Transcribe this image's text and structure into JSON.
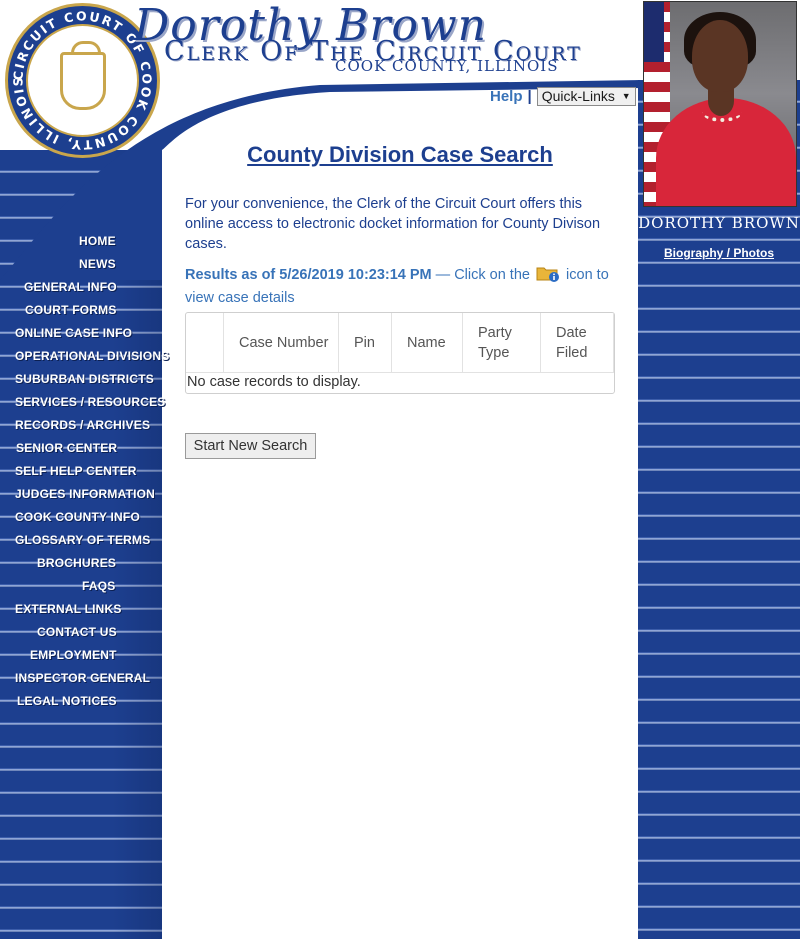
{
  "header": {
    "name": "Dorothy Brown",
    "office": "Clerk Of The Circuit Court",
    "county": "Cook County, Illinois",
    "seal_text": "CIRCUIT COURT OF COOK COUNTY, ILLINOIS"
  },
  "toplinks": {
    "help": "Help",
    "separator": "|",
    "quicklinks": "Quick-Links"
  },
  "sidebar": {
    "bio_name": "DOROTHY BROWN",
    "bio_link": "Biography / Photos"
  },
  "nav": [
    {
      "label": "HOME"
    },
    {
      "label": "NEWS"
    },
    {
      "label": "GENERAL INFO"
    },
    {
      "label": "COURT FORMS"
    },
    {
      "label": "ONLINE CASE INFO"
    },
    {
      "label": "OPERATIONAL DIVISIONS"
    },
    {
      "label": "SUBURBAN DISTRICTS"
    },
    {
      "label": "SERVICES / RESOURCES"
    },
    {
      "label": "RECORDS / ARCHIVES"
    },
    {
      "label": "SENIOR CENTER"
    },
    {
      "label": "SELF HELP CENTER"
    },
    {
      "label": "JUDGES INFORMATION"
    },
    {
      "label": "COOK COUNTY INFO"
    },
    {
      "label": "GLOSSARY OF TERMS"
    },
    {
      "label": "BROCHURES"
    },
    {
      "label": "FAQS"
    },
    {
      "label": "EXTERNAL LINKS"
    },
    {
      "label": "CONTACT US"
    },
    {
      "label": "EMPLOYMENT"
    },
    {
      "label": "INSPECTOR GENERAL"
    },
    {
      "label": "LEGAL NOTICES"
    }
  ],
  "main": {
    "title": "County Division Case Search",
    "intro": "For your convenience, the Clerk of the Circuit Court offers this online access to electronic docket information for County Divison cases.",
    "results_label": "Results as of 5/26/2019 10:23:14 PM",
    "results_text_1": "— Click on the",
    "results_text_2": "icon to view case details",
    "columns": [
      "",
      "Case Number",
      "Pin",
      "Name",
      "Party Type",
      "Date Filed"
    ],
    "empty_message": "No case records to display.",
    "new_search_button": "Start New Search"
  },
  "colors": {
    "navy": "#1d3f8f",
    "link_blue": "#3873b8"
  }
}
